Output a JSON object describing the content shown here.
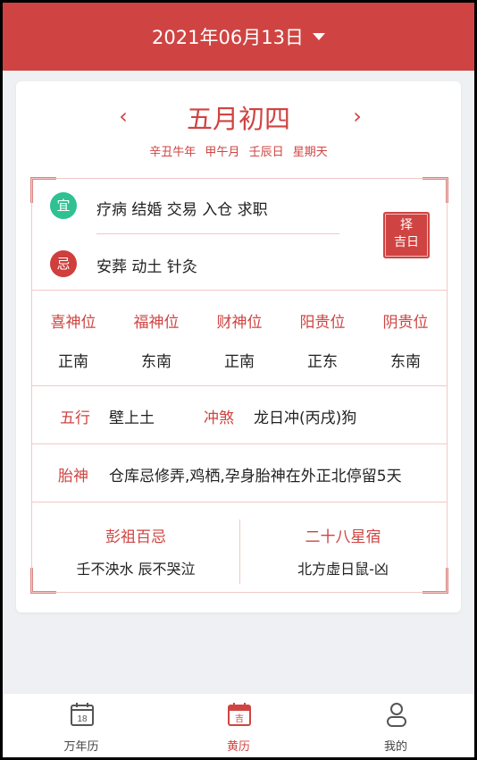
{
  "header": {
    "date_label": "2021年06月13日"
  },
  "lunar": {
    "title": "五月初四",
    "prev_glyph": "‹",
    "next_glyph": "›",
    "ganzhi": [
      "辛丑牛年",
      "甲午月",
      "壬辰日",
      "星期天"
    ]
  },
  "yiji": {
    "yi_badge": "宜",
    "yi_text": "疗病 结婚 交易 入仓 求职",
    "ji_badge": "忌",
    "ji_text": "安葬 动土 针灸",
    "zeji_line1": "择",
    "zeji_line2": "吉日"
  },
  "directions": [
    {
      "label": "喜神位",
      "value": "正南"
    },
    {
      "label": "福神位",
      "value": "东南"
    },
    {
      "label": "财神位",
      "value": "正南"
    },
    {
      "label": "阳贵位",
      "value": "正东"
    },
    {
      "label": "阴贵位",
      "value": "东南"
    }
  ],
  "wuxing": {
    "label": "五行",
    "value": "壁上土",
    "chongsha_label": "冲煞",
    "chongsha_value": "龙日冲(丙戌)狗"
  },
  "taishen": {
    "label": "胎神",
    "value": "仓库忌修弄,鸡栖,孕身胎神在外正北停留5天"
  },
  "pengzu": {
    "label": "彭祖百忌",
    "value": "壬不泱水 辰不哭泣"
  },
  "xingxiu": {
    "label": "二十八星宿",
    "value": "北方虚日鼠-凶"
  },
  "tabbar": {
    "tabs": [
      {
        "label": "万年历",
        "icon": "calendar-icon",
        "icon_text": "18"
      },
      {
        "label": "黄历",
        "icon": "almanac-icon",
        "icon_text": "吉"
      },
      {
        "label": "我的",
        "icon": "user-icon"
      }
    ],
    "active_index": 1
  },
  "colors": {
    "accent": "#cf4442",
    "yi_green": "#2fc191",
    "ji_red": "#cf3f3c",
    "border": "#f1c9c6"
  }
}
